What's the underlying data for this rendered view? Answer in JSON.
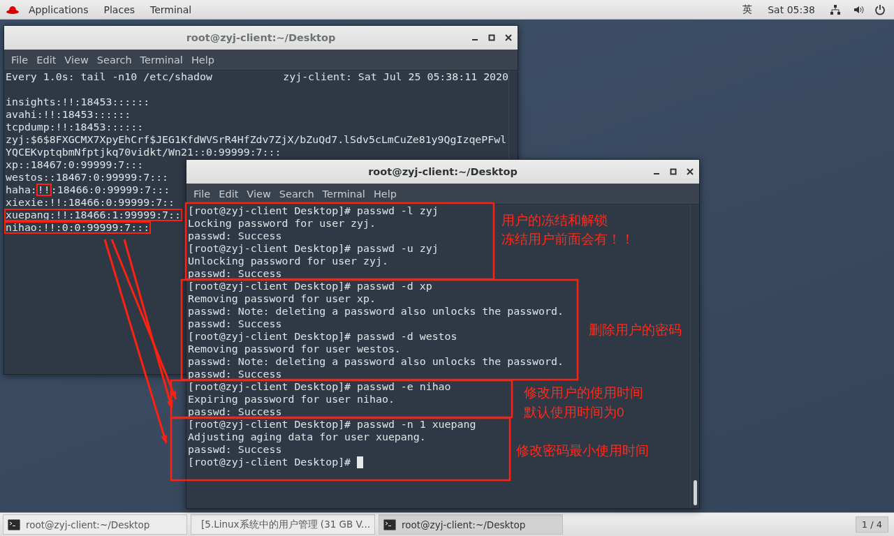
{
  "top_bar": {
    "menus": [
      "Applications",
      "Places",
      "Terminal"
    ],
    "input_method": "英",
    "clock": "Sat 05:38"
  },
  "windows": [
    {
      "title": "root@zyj-client:~/Desktop",
      "active": false,
      "menu": [
        "File",
        "Edit",
        "View",
        "Search",
        "Terminal",
        "Help"
      ],
      "header": "Every 1.0s: tail -n10 /etc/shadow",
      "header_right": "zyj-client: Sat Jul 25 05:38:11 2020",
      "cursor": false,
      "lines": [
        "insights:!!:18453::::::",
        "avahi:!!:18453::::::",
        "tcpdump:!!:18453::::::",
        "zyj:$6$8FXGCMX7XpyEhCrf$JEG1KfdWVSrR4HfZdv7ZjX/bZuQd7.lSdv5cLmCuZe81y9QgIzqePFwl",
        "YQCEKvptqbmNfptjkq70vidkt/Wn21::0:99999:7:::",
        "xp::18467:0:99999:7:::",
        "westos::18467:0:99999:7:::",
        {
          "parts": [
            {
              "text": "haha:",
              "boxed": false
            },
            {
              "text": "!!",
              "boxed": true
            },
            {
              "text": ":18466:0:99999:7:::",
              "boxed": false
            }
          ]
        },
        "xiexie:!!:18466:0:99999:7::",
        {
          "text": "xuepang:!!:18466:1:99999:7::",
          "boxed": true
        },
        {
          "text": "nihao:!!:0:0:99999:7:::",
          "boxed": true
        }
      ]
    },
    {
      "title": "root@zyj-client:~/Desktop",
      "active": true,
      "menu": [
        "File",
        "Edit",
        "View",
        "Search",
        "Terminal",
        "Help"
      ],
      "cursor": true,
      "lines": [
        "[root@zyj-client Desktop]# passwd -l zyj",
        "Locking password for user zyj.",
        "passwd: Success",
        "[root@zyj-client Desktop]# passwd -u zyj",
        "Unlocking password for user zyj.",
        "passwd: Success",
        "[root@zyj-client Desktop]# passwd -d xp",
        "Removing password for user xp.",
        "passwd: Note: deleting a password also unlocks the password.",
        "passwd: Success",
        "[root@zyj-client Desktop]# passwd -d westos",
        "Removing password for user westos.",
        "passwd: Note: deleting a password also unlocks the password.",
        "passwd: Success",
        "[root@zyj-client Desktop]# passwd -e nihao",
        "Expiring password for user nihao.",
        "passwd: Success",
        "[root@zyj-client Desktop]# passwd -n 1 xuepang",
        "Adjusting aging data for user xuepang.",
        "passwd: Success",
        "[root@zyj-client Desktop]# "
      ]
    }
  ],
  "annotations": [
    {
      "text": "用户的冻结和解锁"
    },
    {
      "text": "冻结用户前面会有！！"
    },
    {
      "text": "删除用户的密码"
    },
    {
      "text": "修改用户的使用时间"
    },
    {
      "text": "默认使用时间为0"
    },
    {
      "text": "修改密码最小使用时间"
    }
  ],
  "taskbar": {
    "items": [
      {
        "label": "root@zyj-client:~/Desktop",
        "kind": "terminal",
        "selected": false
      },
      {
        "label": "[5.Linux系统中的用户管理 (31 GB V...",
        "kind": "editor",
        "selected": false
      },
      {
        "label": "root@zyj-client:~/Desktop",
        "kind": "terminal",
        "selected": true
      }
    ],
    "workspace": "1 / 4"
  }
}
